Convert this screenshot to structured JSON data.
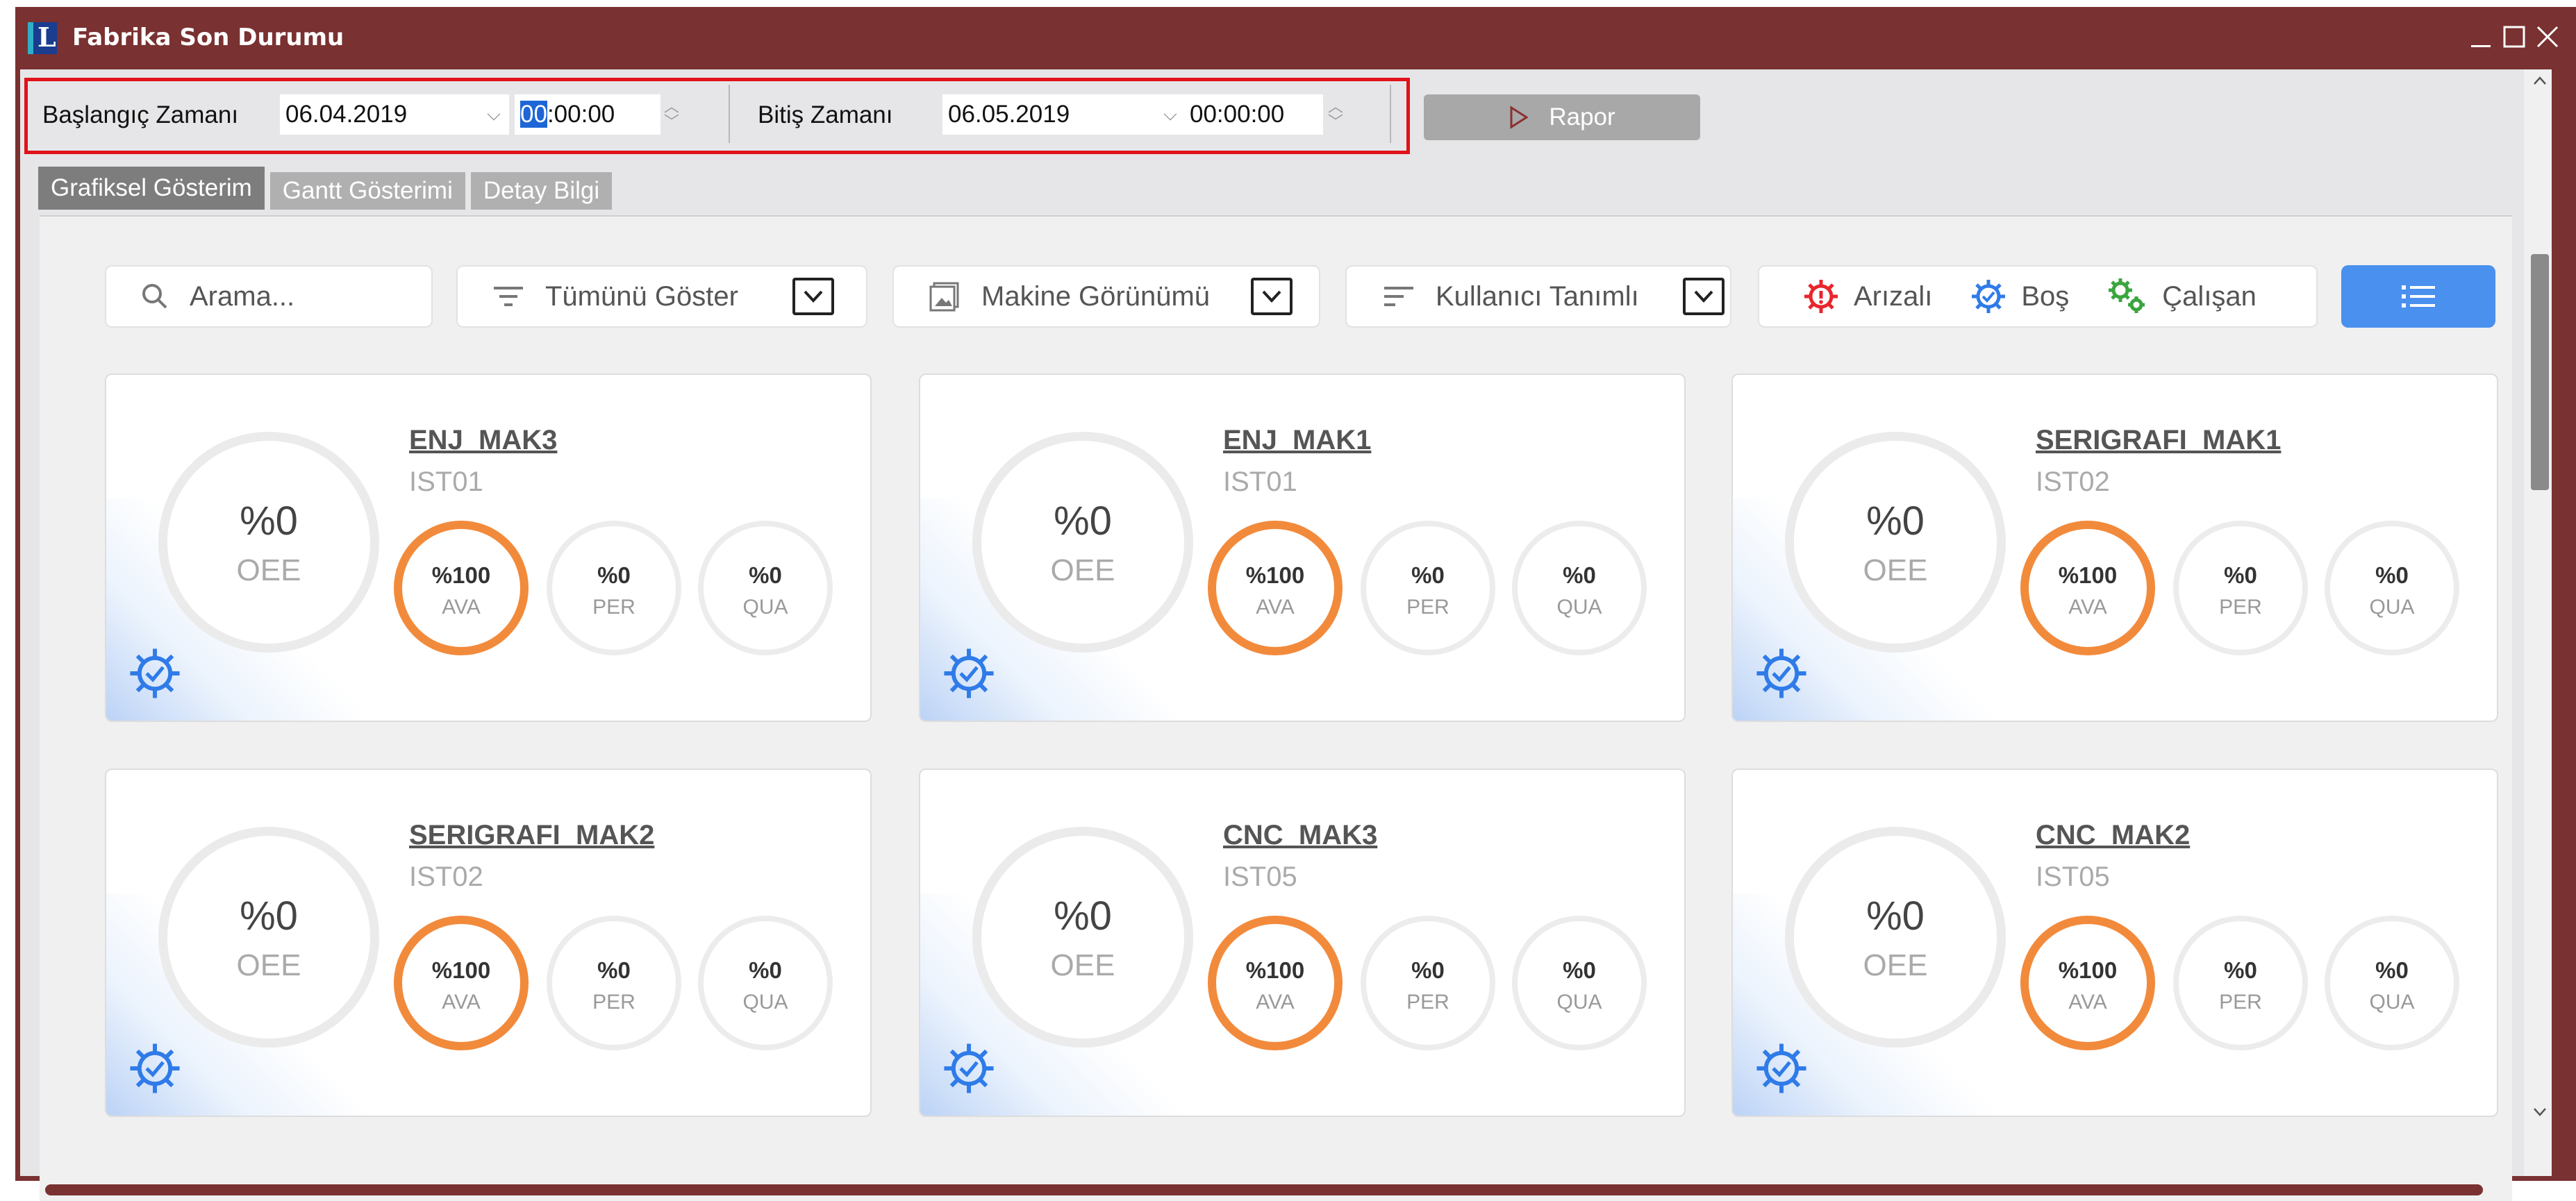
{
  "window": {
    "title": "Fabrika Son Durumu",
    "logo_letter": "L",
    "controls": {
      "minimize": "_",
      "maximize": "☐",
      "close": "✕"
    }
  },
  "toolbar": {
    "start_label": "Başlangıç Zamanı",
    "start_date": "06.04.2019",
    "start_time_hour": "00",
    "start_time_rest": ":00:00",
    "end_label": "Bitiş Zamanı",
    "end_date": "06.05.2019",
    "end_time": "00:00:00",
    "report_button": "Rapor"
  },
  "tabs": [
    {
      "label": "Grafiksel Gösterim",
      "active": true
    },
    {
      "label": "Gantt Gösterimi",
      "active": false
    },
    {
      "label": "Detay Bilgi",
      "active": false
    }
  ],
  "filters": {
    "search_placeholder": "Arama...",
    "filter_option": "Tümünü Göster",
    "view_option": "Makine Görünümü",
    "sort_option": "Kullanıcı Tanımlı",
    "status_faulty": "Arızalı",
    "status_idle": "Boş",
    "status_running": "Çalışan"
  },
  "colors": {
    "frame": "#7a3131",
    "accent_blue": "#4a90ee",
    "ava_ring": "#f28a3c",
    "faulty": "#e8262c",
    "idle": "#2f7be8",
    "running": "#3aa53f",
    "highlight_border": "#e0121a"
  },
  "machines": [
    {
      "name": "ENJ_MAK3",
      "station": "IST01",
      "oee": "%0",
      "oee_label": "OEE",
      "ava": "%100",
      "ava_label": "AVA",
      "per": "%0",
      "per_label": "PER",
      "qua": "%0",
      "qua_label": "QUA"
    },
    {
      "name": "ENJ_MAK1",
      "station": "IST01",
      "oee": "%0",
      "oee_label": "OEE",
      "ava": "%100",
      "ava_label": "AVA",
      "per": "%0",
      "per_label": "PER",
      "qua": "%0",
      "qua_label": "QUA"
    },
    {
      "name": "SERIGRAFI_MAK1",
      "station": "IST02",
      "oee": "%0",
      "oee_label": "OEE",
      "ava": "%100",
      "ava_label": "AVA",
      "per": "%0",
      "per_label": "PER",
      "qua": "%0",
      "qua_label": "QUA"
    },
    {
      "name": "SERIGRAFI_MAK2",
      "station": "IST02",
      "oee": "%0",
      "oee_label": "OEE",
      "ava": "%100",
      "ava_label": "AVA",
      "per": "%0",
      "per_label": "PER",
      "qua": "%0",
      "qua_label": "QUA"
    },
    {
      "name": "CNC_MAK3",
      "station": "IST05",
      "oee": "%0",
      "oee_label": "OEE",
      "ava": "%100",
      "ava_label": "AVA",
      "per": "%0",
      "per_label": "PER",
      "qua": "%0",
      "qua_label": "QUA"
    },
    {
      "name": "CNC_MAK2",
      "station": "IST05",
      "oee": "%0",
      "oee_label": "OEE",
      "ava": "%100",
      "ava_label": "AVA",
      "per": "%0",
      "per_label": "PER",
      "qua": "%0",
      "qua_label": "QUA"
    }
  ]
}
